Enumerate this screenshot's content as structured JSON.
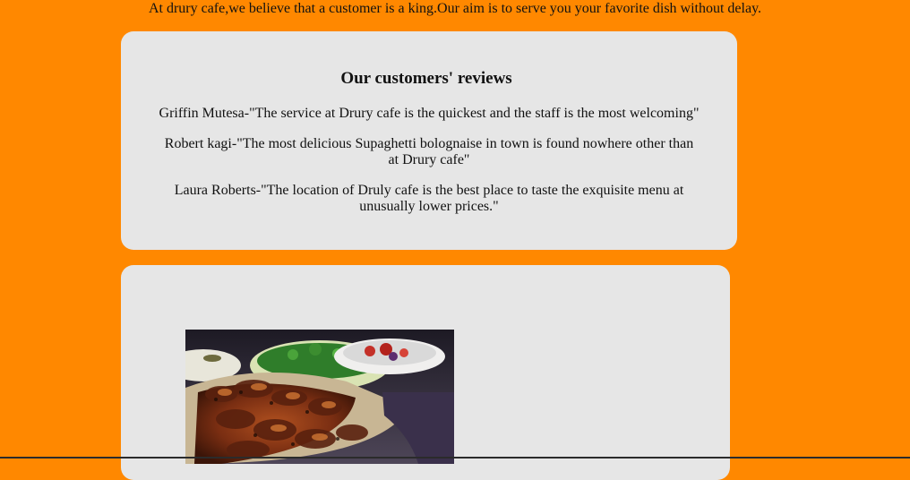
{
  "intro": {
    "text": "At drury cafe,we believe that a customer is a king.Our aim is to serve you your favorite dish without delay."
  },
  "reviews": {
    "title": "Our customers' reviews",
    "items": [
      {
        "text": "Griffin Mutesa-\"The service at Drury cafe is the quickest and the staff is the most welcoming\""
      },
      {
        "text": "Robert kagi-\"The most delicious Supaghetti bolognaise in town is found nowhere other than at Drury cafe\""
      },
      {
        "text": "Laura Roberts-\"The location of Druly cafe is the best place to taste the exquisite menu at unusually lower prices.\""
      }
    ]
  },
  "gallery": {
    "image_icon": "food-photo-grilled-chicken"
  },
  "colors": {
    "page_background": "#ff8800",
    "card_background": "#e6e6e6",
    "text": "#111111"
  }
}
